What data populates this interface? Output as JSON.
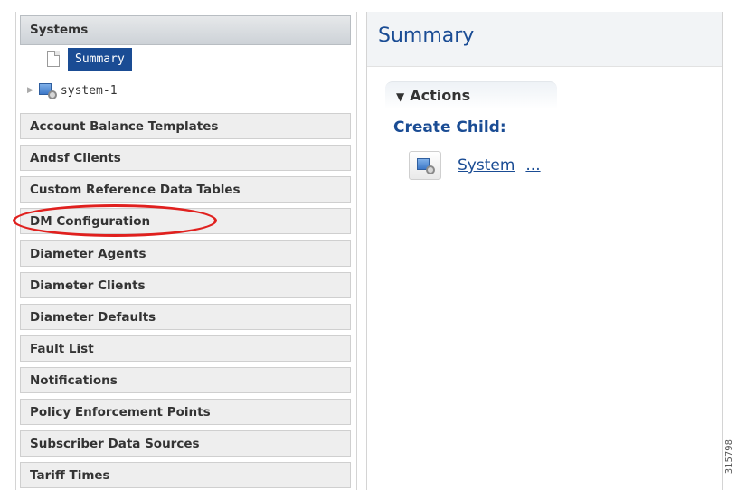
{
  "nav": {
    "systems_header": "Systems",
    "tree": {
      "summary": "Summary",
      "system": "system-1"
    },
    "headers": [
      "Account Balance Templates",
      "Andsf Clients",
      "Custom Reference Data Tables",
      "DM Configuration",
      "Diameter Agents",
      "Diameter Clients",
      "Diameter Defaults",
      "Fault List",
      "Notifications",
      "Policy Enforcement Points",
      "Subscriber Data Sources",
      "Tariff Times"
    ]
  },
  "main": {
    "title": "Summary",
    "actions_label": "Actions",
    "create_child_label": "Create Child:",
    "system_link": "System",
    "system_ellipsis": "..."
  },
  "figure_id": "315798",
  "colors": {
    "selection": "#1a4c94",
    "highlight": "#e0201e"
  }
}
